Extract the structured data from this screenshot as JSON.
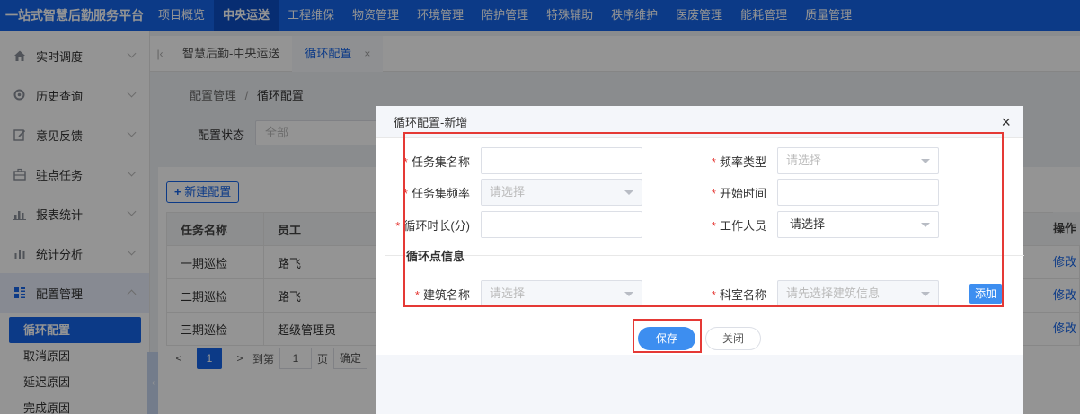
{
  "app": {
    "brand": "一站式智慧后勤服务平台"
  },
  "topnav": {
    "items": [
      "项目概览",
      "中央运送",
      "工程维保",
      "物资管理",
      "环境管理",
      "陪护管理",
      "特殊辅助",
      "秩序维护",
      "医废管理",
      "能耗管理",
      "质量管理"
    ],
    "active_index": 1
  },
  "sidebar": {
    "items": [
      {
        "label": "实时调度",
        "icon": "home-icon"
      },
      {
        "label": "历史查询",
        "icon": "search-icon"
      },
      {
        "label": "意见反馈",
        "icon": "edit-icon"
      },
      {
        "label": "驻点任务",
        "icon": "briefcase-icon"
      },
      {
        "label": "报表统计",
        "icon": "bar-chart-icon"
      },
      {
        "label": "统计分析",
        "icon": "analysis-icon"
      },
      {
        "label": "配置管理",
        "icon": "grid-icon"
      }
    ],
    "sub_items": [
      "循环配置",
      "取消原因",
      "延迟原因",
      "完成原因"
    ],
    "active_sub": "循环配置"
  },
  "tabs": [
    {
      "label": "智慧后勤-中央运送"
    },
    {
      "label": "循环配置",
      "close": "×"
    }
  ],
  "breadcrumb": {
    "parent": "配置管理",
    "separator": "/",
    "current": "循环配置"
  },
  "filter": {
    "label": "配置状态",
    "value": "全部"
  },
  "toolbar": {
    "new_label": "新建配置"
  },
  "table": {
    "headers": [
      "任务名称",
      "员工"
    ],
    "rows": [
      [
        "一期巡检",
        "路飞"
      ],
      [
        "二期巡检",
        "路飞"
      ],
      [
        "三期巡检",
        "超级管理员"
      ]
    ],
    "op_header": "操作",
    "op_link": "修改"
  },
  "pagination": {
    "prev": "<",
    "current": "1",
    "next": ">",
    "goto_label": "到第",
    "page_value": "1",
    "page_unit": "页",
    "confirm": "确定"
  },
  "modal": {
    "title": "循环配置-新增",
    "close": "×",
    "fields": {
      "task_set_name": {
        "label": "任务集名称",
        "value": ""
      },
      "frequency_type": {
        "label": "频率类型",
        "placeholder": "请选择"
      },
      "task_set_frequency": {
        "label": "任务集频率",
        "placeholder": "请选择"
      },
      "start_time": {
        "label": "开始时间",
        "value": ""
      },
      "cycle_duration": {
        "label": "循环时长(分)",
        "value": ""
      },
      "worker": {
        "label": "工作人员",
        "value": "请选择"
      }
    },
    "section_title": "循环点信息",
    "building": {
      "label": "建筑名称",
      "placeholder": "请选择"
    },
    "department": {
      "label": "科室名称",
      "placeholder": "请先选择建筑信息"
    },
    "add_label": "添加",
    "save_label": "保存",
    "close_label": "关闭",
    "required_mark": "*"
  },
  "colors": {
    "primary": "#1565e8",
    "highlight": "#e53935",
    "button": "#3d8ef0"
  }
}
